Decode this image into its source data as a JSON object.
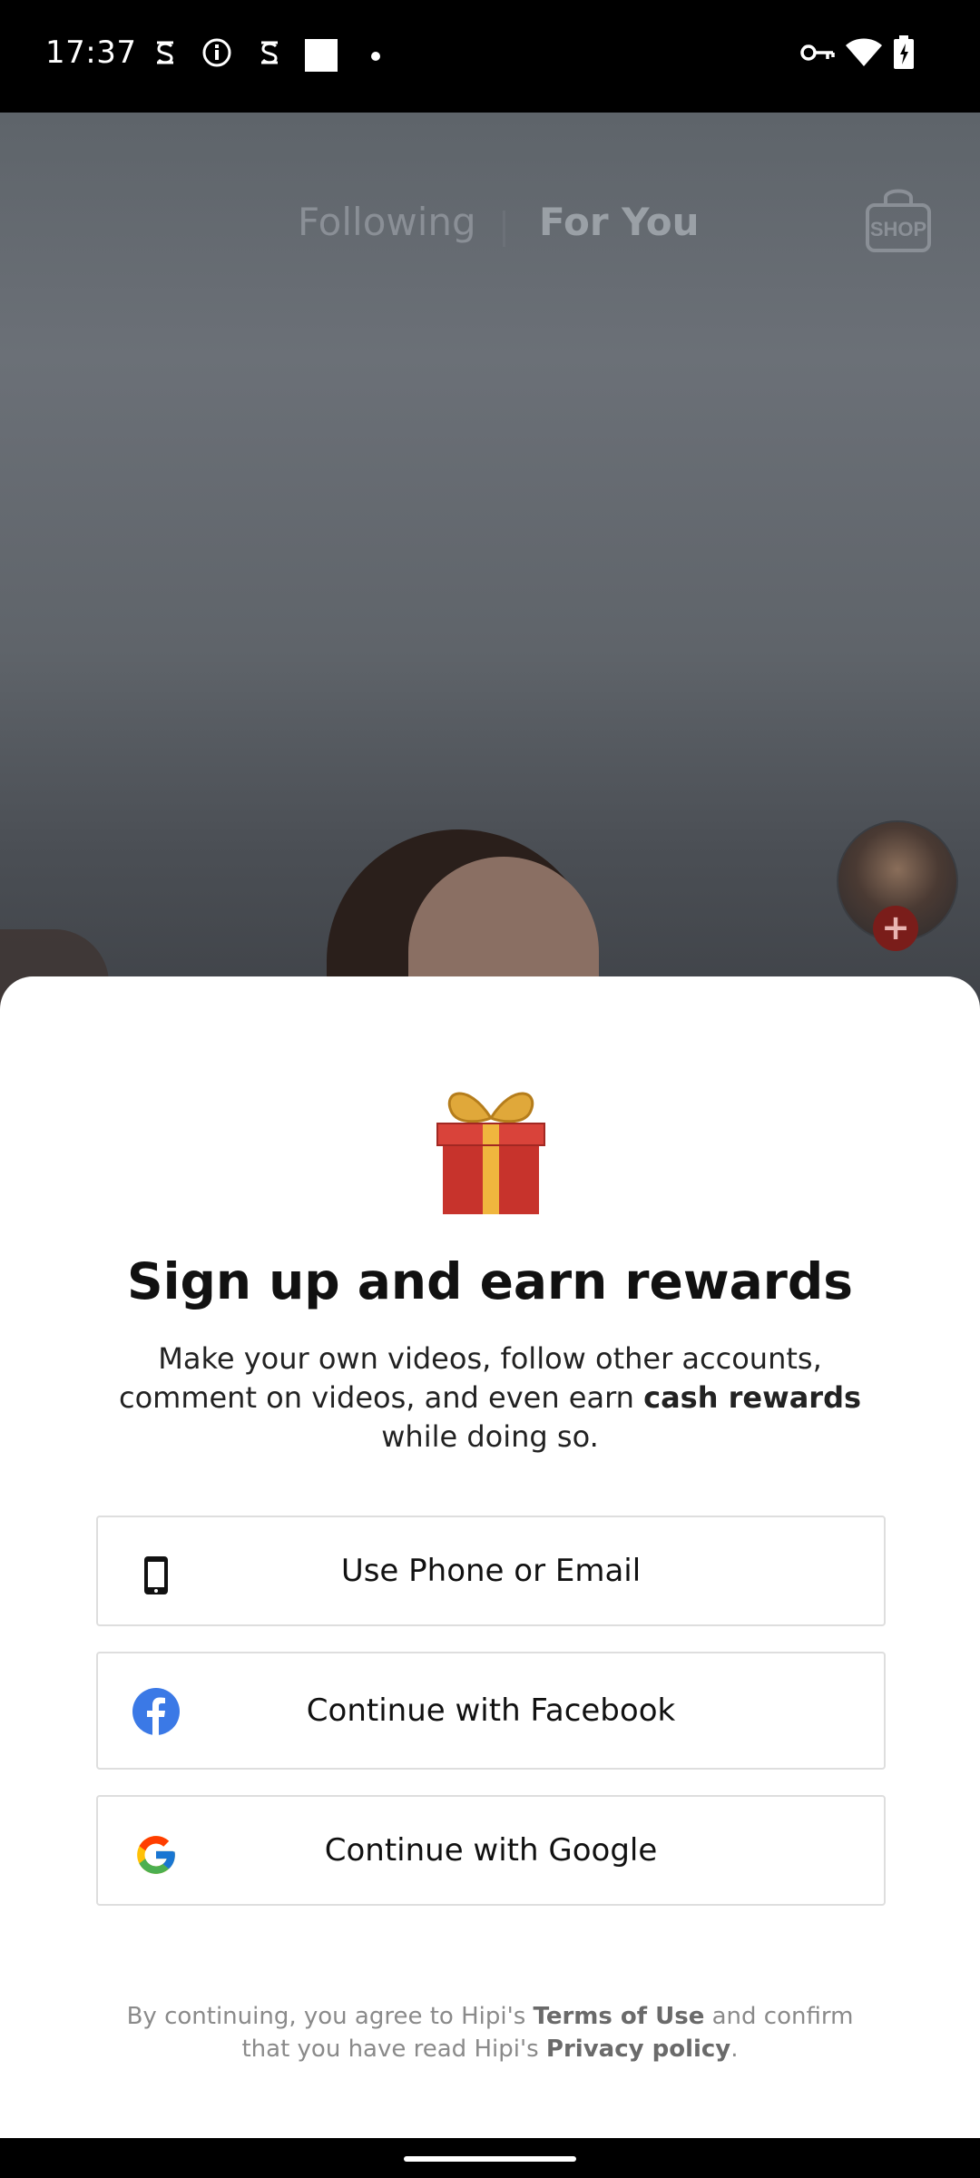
{
  "status_bar": {
    "time": "17:37"
  },
  "video": {
    "tabs": {
      "following": "Following",
      "for_you": "For You"
    },
    "shop_label": "SHOP",
    "follow_plus": "+"
  },
  "sheet": {
    "title": "Sign up and earn rewards",
    "subtitle_part1": "Make your own videos, follow other accounts, comment on videos, and even earn ",
    "subtitle_bold": "cash rewards",
    "subtitle_part2": " while doing so.",
    "buttons": {
      "phone_email": "Use Phone or Email",
      "facebook": "Continue with Facebook",
      "google": "Continue with Google"
    },
    "legal": {
      "prefix": "By continuing, you agree to Hipi's ",
      "terms": "Terms of Use",
      "middle": " and confirm that you have read Hipi's ",
      "privacy": "Privacy policy",
      "suffix": "."
    }
  },
  "colors": {
    "facebook_blue": "#3b79e6",
    "brand_red": "#7a1d1a"
  }
}
